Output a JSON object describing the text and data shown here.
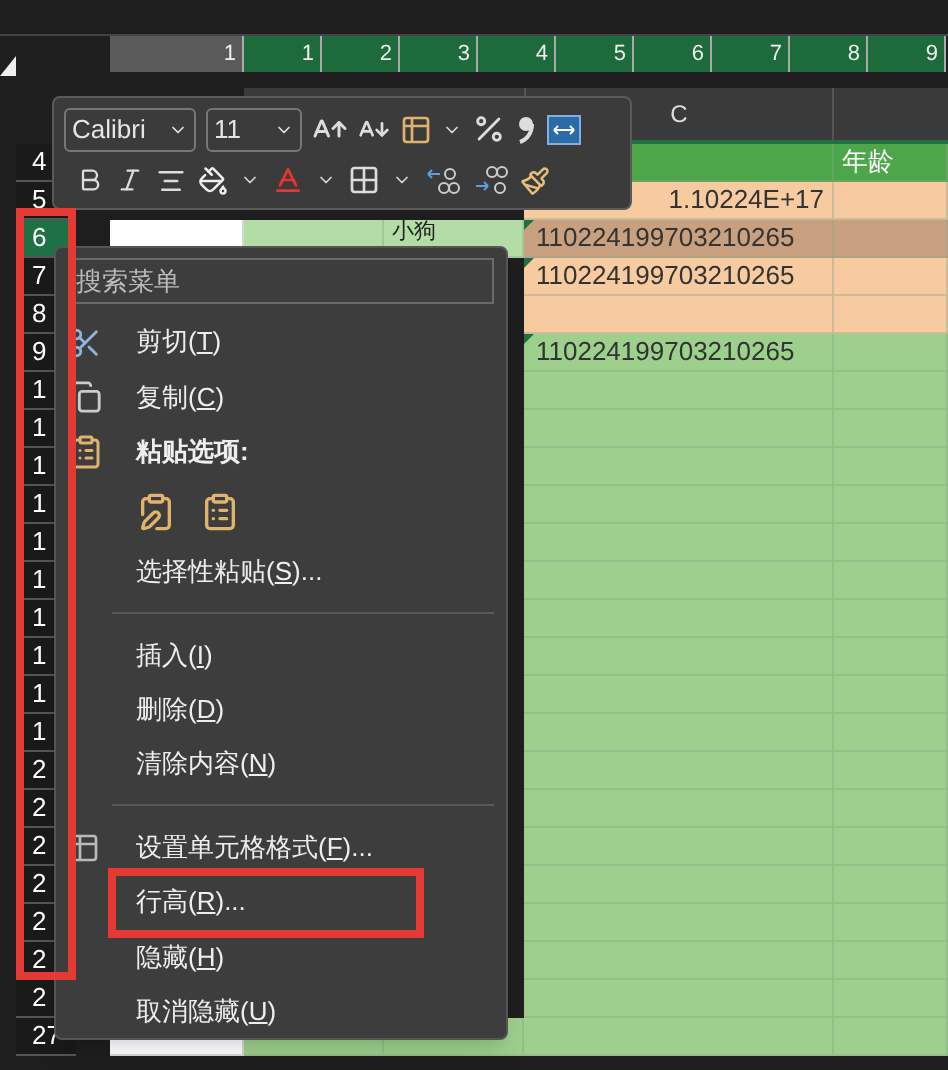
{
  "ruler": {
    "ticks": [
      {
        "label": "1",
        "selected": false
      },
      {
        "label": "1",
        "selected": true
      },
      {
        "label": "2",
        "selected": true
      },
      {
        "label": "3",
        "selected": true
      },
      {
        "label": "4",
        "selected": true
      },
      {
        "label": "5",
        "selected": true
      },
      {
        "label": "6",
        "selected": true
      },
      {
        "label": "7",
        "selected": true
      },
      {
        "label": "8",
        "selected": true
      },
      {
        "label": "9",
        "selected": true
      }
    ]
  },
  "column_header": "C",
  "row_groups": [
    {
      "outlined": false,
      "rows": [
        {
          "number": "4",
          "selected": false,
          "cells": [
            {
              "color": "#4da64a"
            },
            {
              "color": "#4da64a",
              "text": "年龄",
              "kind": "heading"
            }
          ]
        },
        {
          "number": "5",
          "selected": false,
          "cells": [
            {
              "color": "#f8caa0",
              "text": "1.10224E+17",
              "kind": "number"
            },
            {
              "color": "#f8caa0"
            }
          ]
        }
      ]
    },
    {
      "outlined": true,
      "rows": [
        {
          "number": "6",
          "selected": true,
          "left_cells": [
            {
              "color": "#ffffff"
            },
            {
              "color": "#b3dca6"
            },
            {
              "color": "#b3dca6",
              "text": "小狗",
              "kind": "label"
            }
          ],
          "cells": [
            {
              "color": "#c9a07f",
              "text": "110224199703210265",
              "kind": "text"
            },
            {
              "color": "#c9a07f"
            }
          ]
        },
        {
          "number": "7",
          "selected": false,
          "cells": [
            {
              "color": "#f8caa0",
              "text": "110224199703210265",
              "kind": "text"
            },
            {
              "color": "#f8caa0"
            }
          ]
        },
        {
          "number": "8",
          "selected": false,
          "cells": [
            {
              "color": "#f8caa0"
            },
            {
              "color": "#f8caa0"
            }
          ]
        },
        {
          "number": "9",
          "selected": false,
          "cells": [
            {
              "color": "#9dcf8d",
              "text": "110224199703210265",
              "kind": "text"
            },
            {
              "color": "#9dcf8d"
            }
          ]
        },
        {
          "number": "1",
          "selected": false,
          "cells": [
            {
              "color": "#9dcf8d"
            },
            {
              "color": "#9dcf8d"
            }
          ]
        },
        {
          "number": "1",
          "selected": false,
          "cells": [
            {
              "color": "#9dcf8d"
            },
            {
              "color": "#9dcf8d"
            }
          ]
        },
        {
          "number": "1",
          "selected": false,
          "cells": [
            {
              "color": "#9dcf8d"
            },
            {
              "color": "#9dcf8d"
            }
          ]
        },
        {
          "number": "1",
          "selected": false,
          "cells": [
            {
              "color": "#9dcf8d"
            },
            {
              "color": "#9dcf8d"
            }
          ]
        },
        {
          "number": "1",
          "selected": false,
          "cells": [
            {
              "color": "#9dcf8d"
            },
            {
              "color": "#9dcf8d"
            }
          ]
        },
        {
          "number": "1",
          "selected": false,
          "cells": [
            {
              "color": "#9dcf8d"
            },
            {
              "color": "#9dcf8d"
            }
          ]
        },
        {
          "number": "1",
          "selected": false,
          "cells": [
            {
              "color": "#9dcf8d"
            },
            {
              "color": "#9dcf8d"
            }
          ]
        },
        {
          "number": "1",
          "selected": false,
          "cells": [
            {
              "color": "#9dcf8d"
            },
            {
              "color": "#9dcf8d"
            }
          ]
        },
        {
          "number": "1",
          "selected": false,
          "cells": [
            {
              "color": "#9dcf8d"
            },
            {
              "color": "#9dcf8d"
            }
          ]
        },
        {
          "number": "1",
          "selected": false,
          "cells": [
            {
              "color": "#9dcf8d"
            },
            {
              "color": "#9dcf8d"
            }
          ]
        },
        {
          "number": "2",
          "selected": false,
          "cells": [
            {
              "color": "#9dcf8d"
            },
            {
              "color": "#9dcf8d"
            }
          ]
        },
        {
          "number": "2",
          "selected": false,
          "cells": [
            {
              "color": "#9dcf8d"
            },
            {
              "color": "#9dcf8d"
            }
          ]
        },
        {
          "number": "2",
          "selected": false,
          "cells": [
            {
              "color": "#9dcf8d"
            },
            {
              "color": "#9dcf8d"
            }
          ]
        },
        {
          "number": "2",
          "selected": false,
          "cells": [
            {
              "color": "#9dcf8d"
            },
            {
              "color": "#9dcf8d"
            }
          ]
        },
        {
          "number": "2",
          "selected": false,
          "cells": [
            {
              "color": "#9dcf8d"
            },
            {
              "color": "#9dcf8d"
            }
          ]
        },
        {
          "number": "2",
          "selected": false,
          "cells": [
            {
              "color": "#9dcf8d"
            },
            {
              "color": "#9dcf8d"
            }
          ]
        }
      ]
    },
    {
      "outlined": false,
      "rows": [
        {
          "number": "2",
          "selected": false,
          "cells": [
            {
              "color": "#9dcf8d"
            },
            {
              "color": "#9dcf8d"
            }
          ]
        },
        {
          "number": "27",
          "selected": false,
          "left_cells": [
            {
              "color": "#ffffff"
            },
            {
              "color": "#9dcf8d"
            },
            {
              "color": "#9dcf8d"
            }
          ],
          "cells": [
            {
              "color": "#9dcf8d"
            },
            {
              "color": "#9dcf8d"
            }
          ]
        }
      ]
    }
  ],
  "mini_toolbar": {
    "font": "Calibri",
    "size": "11"
  },
  "context_menu": {
    "search": {
      "placeholder": "搜索菜单"
    },
    "items": [
      {
        "kind": "cut",
        "label": "剪切(",
        "key": "T",
        "after": ")",
        "outlined": false
      },
      {
        "kind": "copy",
        "label": "复制(",
        "key": "C",
        "after": ")",
        "outlined": false
      },
      {
        "kind": "header",
        "label": "粘贴选项:"
      },
      {
        "kind": "paste_options"
      },
      {
        "kind": "item",
        "label": "选择性粘贴(",
        "key": "S",
        "after": ")...",
        "outlined": false
      },
      {
        "kind": "separator"
      },
      {
        "kind": "item",
        "label": "插入(",
        "key": "I",
        "after": ")",
        "outlined": false
      },
      {
        "kind": "item",
        "label": "删除(",
        "key": "D",
        "after": ")",
        "outlined": false
      },
      {
        "kind": "item",
        "label": "清除内容(",
        "key": "N",
        "after": ")",
        "outlined": false
      },
      {
        "kind": "separator"
      },
      {
        "kind": "format",
        "label": "设置单元格格式(",
        "key": "F",
        "after": ")...",
        "outlined": false
      },
      {
        "kind": "item",
        "label": "行高(",
        "key": "R",
        "after": ")...",
        "outlined": true
      },
      {
        "kind": "item",
        "label": "隐藏(",
        "key": "H",
        "after": ")",
        "outlined": false
      },
      {
        "kind": "item",
        "label": "取消隐藏(",
        "key": "U",
        "after": ")",
        "outlined": false
      }
    ]
  }
}
